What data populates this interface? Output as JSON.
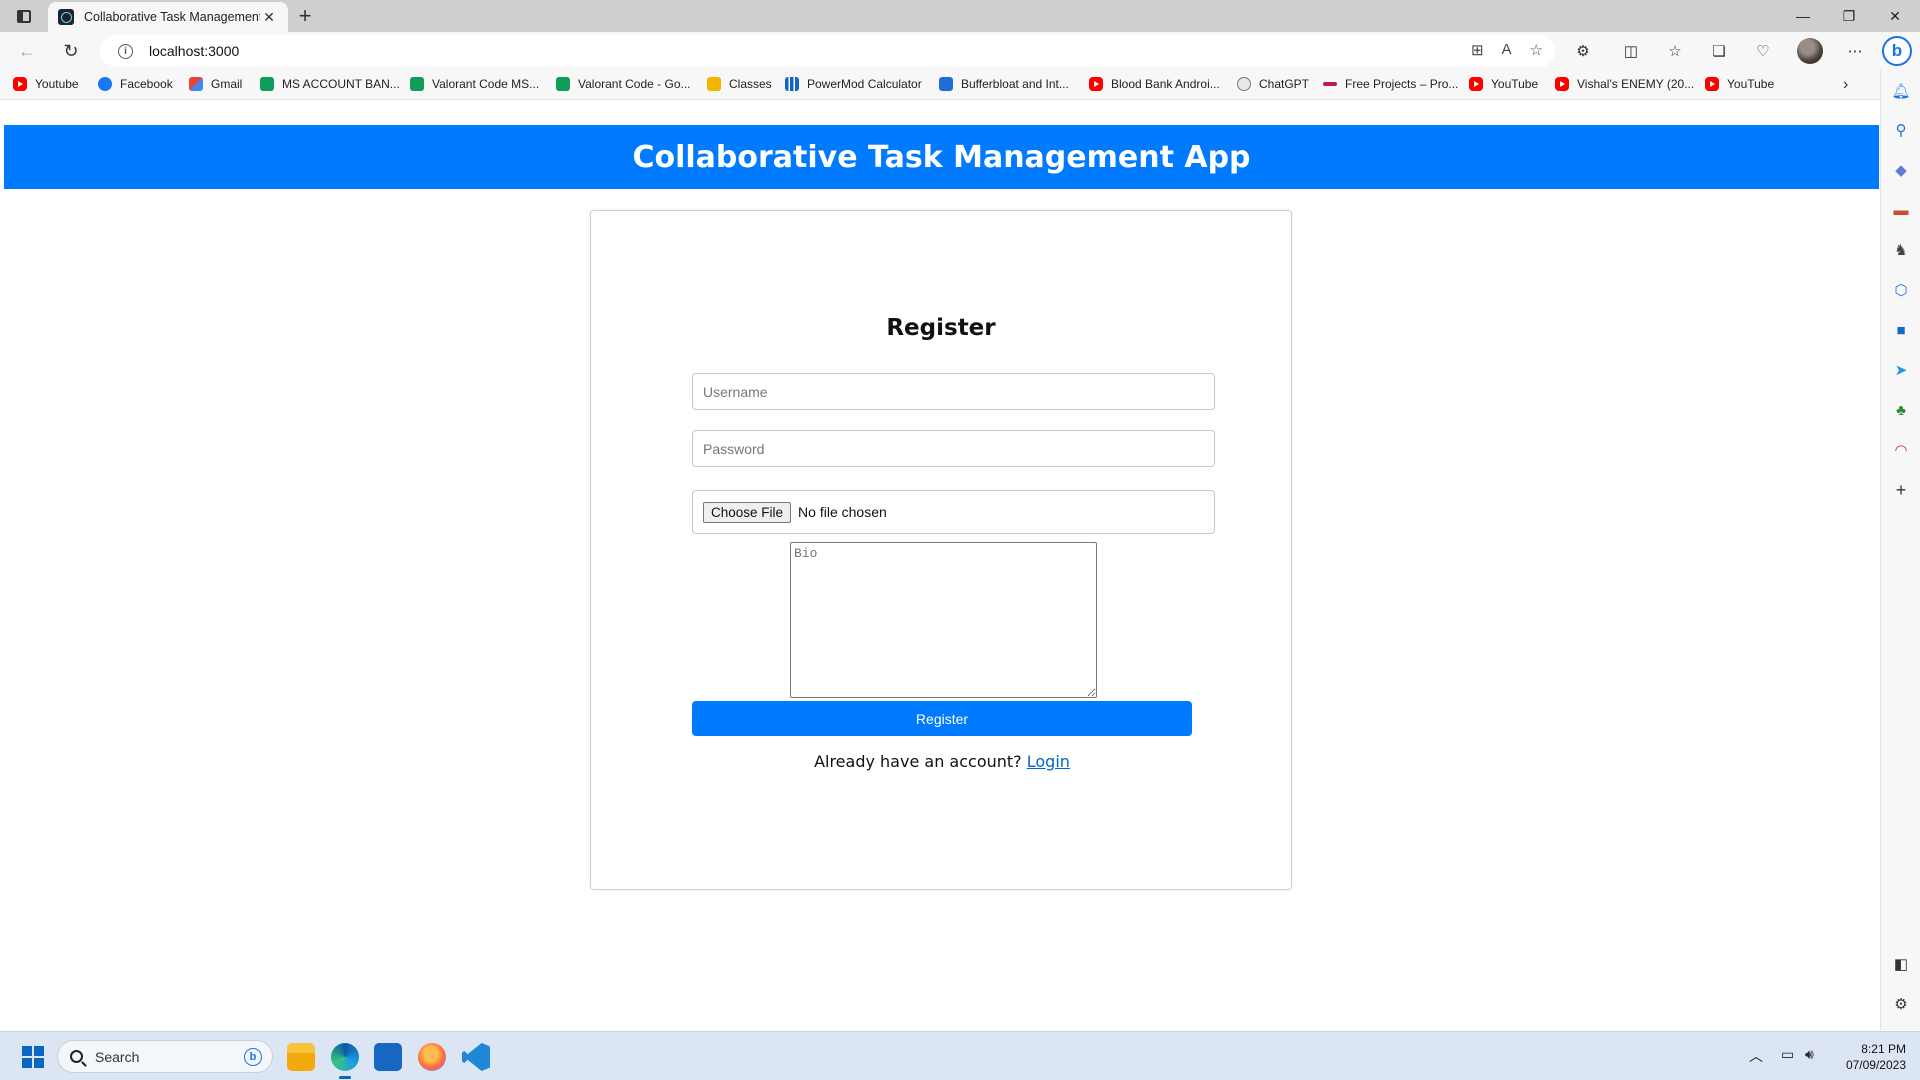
{
  "browser": {
    "tab_title": "Collaborative Task Management",
    "tab_close": "✕",
    "new_tab": "+",
    "window_controls": [
      "—",
      "❐",
      "✕"
    ],
    "address": "localhost:3000",
    "info_glyph": "i"
  },
  "bookmarks": [
    {
      "label": "Youtube",
      "icon": "youtube-icon"
    },
    {
      "label": "Facebook",
      "icon": "facebook-icon"
    },
    {
      "label": "Gmail",
      "icon": "gmail-icon"
    },
    {
      "label": "MS ACCOUNT BAN...",
      "icon": "sheets-icon"
    },
    {
      "label": "Valorant Code MS...",
      "icon": "sheets-icon"
    },
    {
      "label": "Valorant Code - Go...",
      "icon": "sheets-icon"
    },
    {
      "label": "Classes",
      "icon": "classroom-icon"
    },
    {
      "label": "PowerMod Calculator",
      "icon": "powermod-icon"
    },
    {
      "label": "Bufferbloat and Int...",
      "icon": "waveform-icon"
    },
    {
      "label": "Blood Bank Androi...",
      "icon": "youtube-icon"
    },
    {
      "label": "ChatGPT",
      "icon": "chatgpt-icon"
    },
    {
      "label": "Free Projects – Pro...",
      "icon": "projects-icon"
    },
    {
      "label": "YouTube",
      "icon": "youtube-icon"
    },
    {
      "label": "Vishal's ENEMY (20...",
      "icon": "youtube-icon"
    },
    {
      "label": "YouTube",
      "icon": "youtube-icon"
    }
  ],
  "app": {
    "header_title": "Collaborative Task Management App",
    "form_title": "Register",
    "username_placeholder": "Username",
    "password_placeholder": "Password",
    "choose_file_label": "Choose File",
    "no_file_text": "No file chosen",
    "bio_placeholder": "Bio",
    "register_button": "Register",
    "login_prompt": "Already have an account?",
    "login_link": "Login"
  },
  "taskbar": {
    "search_label": "Search",
    "time": "8:21 PM",
    "date": "07/09/2023"
  },
  "colors": {
    "primary": "#007bff",
    "link": "#0066cc"
  }
}
